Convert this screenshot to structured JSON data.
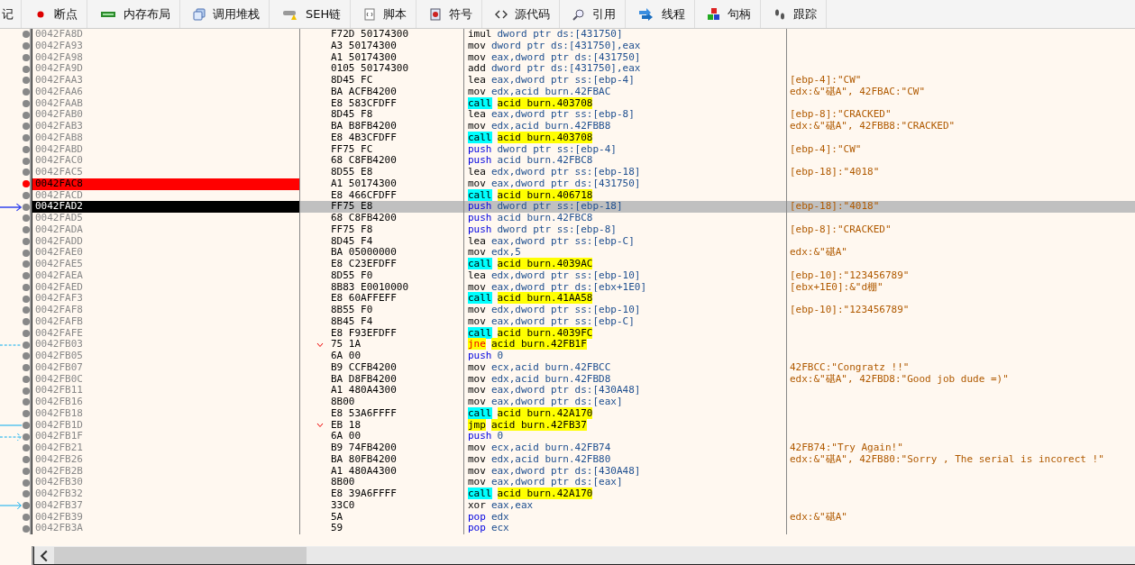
{
  "tabs": [
    {
      "label": "记",
      "selected": false
    },
    {
      "label": "断点",
      "selected": false
    },
    {
      "label": "内存布局",
      "selected": false
    },
    {
      "label": "调用堆栈",
      "selected": false
    },
    {
      "label": "SEH链",
      "selected": false
    },
    {
      "label": "脚本",
      "selected": false
    },
    {
      "label": "符号",
      "selected": false
    },
    {
      "label": "源代码",
      "selected": false
    },
    {
      "label": "引用",
      "selected": false
    },
    {
      "label": "线程",
      "selected": false
    },
    {
      "label": "句柄",
      "selected": false
    },
    {
      "label": "跟踪",
      "selected": false
    }
  ],
  "rows": [
    {
      "address": "0042FA8D",
      "bytes": "F72D 50174300",
      "kind": "plain",
      "mnemonic": "imul",
      "operands": "dword ptr ds:[431750]",
      "breakpoint": false,
      "selected": false,
      "branch": false
    },
    {
      "address": "0042FA93",
      "bytes": "A3 50174300",
      "kind": "plain",
      "mnemonic": "mov",
      "operands": "dword ptr ds:[431750],eax",
      "breakpoint": false,
      "selected": false,
      "branch": false
    },
    {
      "address": "0042FA98",
      "bytes": "A1 50174300",
      "kind": "plain",
      "mnemonic": "mov",
      "operands": "eax,dword ptr ds:[431750]",
      "breakpoint": false,
      "selected": false,
      "branch": false
    },
    {
      "address": "0042FA9D",
      "bytes": "0105 50174300",
      "kind": "plain",
      "mnemonic": "add",
      "operands": "dword ptr ds:[431750],eax",
      "breakpoint": false,
      "selected": false,
      "branch": false
    },
    {
      "address": "0042FAA3",
      "bytes": "8D45 FC",
      "kind": "plain",
      "mnemonic": "lea",
      "operands": "eax,dword ptr ss:[ebp-4]",
      "comment": "[ebp-4]:\"CW\"",
      "breakpoint": false,
      "selected": false,
      "branch": false
    },
    {
      "address": "0042FAA6",
      "bytes": "BA ACFB4200",
      "kind": "plain",
      "mnemonic": "mov",
      "operands": "edx,acid burn.42FBAC",
      "comment": "edx:&\"碪A\", 42FBAC:\"CW\"",
      "breakpoint": false,
      "selected": false,
      "branch": false
    },
    {
      "address": "0042FAAB",
      "bytes": "E8 583CFDFF",
      "kind": "call",
      "mnemonic": "call",
      "operands": "acid burn.403708",
      "breakpoint": false,
      "selected": false,
      "branch": false
    },
    {
      "address": "0042FAB0",
      "bytes": "8D45 F8",
      "kind": "plain",
      "mnemonic": "lea",
      "operands": "eax,dword ptr ss:[ebp-8]",
      "comment": "[ebp-8]:\"CRACKED\"",
      "breakpoint": false,
      "selected": false,
      "branch": false
    },
    {
      "address": "0042FAB3",
      "bytes": "BA B8FB4200",
      "kind": "plain",
      "mnemonic": "mov",
      "operands": "edx,acid burn.42FBB8",
      "comment": "edx:&\"碪A\", 42FBB8:\"CRACKED\"",
      "breakpoint": false,
      "selected": false,
      "branch": false
    },
    {
      "address": "0042FAB8",
      "bytes": "E8 4B3CFDFF",
      "kind": "call",
      "mnemonic": "call",
      "operands": "acid burn.403708",
      "breakpoint": false,
      "selected": false,
      "branch": false
    },
    {
      "address": "0042FABD",
      "bytes": "FF75 FC",
      "kind": "stack",
      "mnemonic": "push",
      "operands": "dword ptr ss:[ebp-4]",
      "comment": "[ebp-4]:\"CW\"",
      "breakpoint": false,
      "selected": false,
      "branch": false
    },
    {
      "address": "0042FAC0",
      "bytes": "68 C8FB4200",
      "kind": "stack",
      "mnemonic": "push",
      "operands": "acid burn.42FBC8",
      "breakpoint": false,
      "selected": false,
      "branch": false
    },
    {
      "address": "0042FAC5",
      "bytes": "8D55 E8",
      "kind": "plain",
      "mnemonic": "lea",
      "operands": "edx,dword ptr ss:[ebp-18]",
      "comment": "[ebp-18]:\"4018\"",
      "breakpoint": false,
      "selected": false,
      "branch": false
    },
    {
      "address": "0042FAC8",
      "bytes": "A1 50174300",
      "kind": "plain",
      "mnemonic": "mov",
      "operands": "eax,dword ptr ds:[431750]",
      "breakpoint": true,
      "selected": false,
      "branch": false
    },
    {
      "address": "0042FACD",
      "bytes": "E8 466CFDFF",
      "kind": "call",
      "mnemonic": "call",
      "operands": "acid burn.406718",
      "breakpoint": false,
      "selected": false,
      "branch": false
    },
    {
      "address": "0042FAD2",
      "bytes": "FF75 E8",
      "kind": "stack",
      "mnemonic": "push",
      "operands": "dword ptr ss:[ebp-18]",
      "comment": "[ebp-18]:\"4018\"",
      "breakpoint": false,
      "selected": true,
      "branch": false,
      "gutter": {
        "kind": "eip"
      }
    },
    {
      "address": "0042FAD5",
      "bytes": "68 C8FB4200",
      "kind": "stack",
      "mnemonic": "push",
      "operands": "acid burn.42FBC8",
      "breakpoint": false,
      "selected": false,
      "branch": false
    },
    {
      "address": "0042FADA",
      "bytes": "FF75 F8",
      "kind": "stack",
      "mnemonic": "push",
      "operands": "dword ptr ss:[ebp-8]",
      "comment": "[ebp-8]:\"CRACKED\"",
      "breakpoint": false,
      "selected": false,
      "branch": false
    },
    {
      "address": "0042FADD",
      "bytes": "8D45 F4",
      "kind": "plain",
      "mnemonic": "lea",
      "operands": "eax,dword ptr ss:[ebp-C]",
      "breakpoint": false,
      "selected": false,
      "branch": false
    },
    {
      "address": "0042FAE0",
      "bytes": "BA 05000000",
      "kind": "plain",
      "mnemonic": "mov",
      "operands": "edx,5",
      "comment": "edx:&\"碪A\"",
      "breakpoint": false,
      "selected": false,
      "branch": false
    },
    {
      "address": "0042FAE5",
      "bytes": "E8 C23EFDFF",
      "kind": "call",
      "mnemonic": "call",
      "operands": "acid burn.4039AC",
      "breakpoint": false,
      "selected": false,
      "branch": false
    },
    {
      "address": "0042FAEA",
      "bytes": "8D55 F0",
      "kind": "plain",
      "mnemonic": "lea",
      "operands": "edx,dword ptr ss:[ebp-10]",
      "comment": "[ebp-10]:\"123456789\"",
      "breakpoint": false,
      "selected": false,
      "branch": false
    },
    {
      "address": "0042FAED",
      "bytes": "8B83 E0010000",
      "kind": "plain",
      "mnemonic": "mov",
      "operands": "eax,dword ptr ds:[ebx+1E0]",
      "comment": "[ebx+1E0]:&\"d棚\"",
      "breakpoint": false,
      "selected": false,
      "branch": false
    },
    {
      "address": "0042FAF3",
      "bytes": "E8 60AFFEFF",
      "kind": "call",
      "mnemonic": "call",
      "operands": "acid burn.41AA58",
      "breakpoint": false,
      "selected": false,
      "branch": false
    },
    {
      "address": "0042FAF8",
      "bytes": "8B55 F0",
      "kind": "plain",
      "mnemonic": "mov",
      "operands": "edx,dword ptr ss:[ebp-10]",
      "comment": "[ebp-10]:\"123456789\"",
      "breakpoint": false,
      "selected": false,
      "branch": false
    },
    {
      "address": "0042FAFB",
      "bytes": "8B45 F4",
      "kind": "plain",
      "mnemonic": "mov",
      "operands": "eax,dword ptr ss:[ebp-C]",
      "breakpoint": false,
      "selected": false,
      "branch": false
    },
    {
      "address": "0042FAFE",
      "bytes": "E8 F93EFDFF",
      "kind": "call",
      "mnemonic": "call",
      "operands": "acid burn.4039FC",
      "breakpoint": false,
      "selected": false,
      "branch": false
    },
    {
      "address": "0042FB03",
      "bytes": "75 1A",
      "kind": "cond-jump",
      "mnemonic": "jne",
      "operands": "acid burn.42FB1F",
      "breakpoint": false,
      "selected": false,
      "branch": true,
      "gutter": {
        "kind": "from-dashed"
      }
    },
    {
      "address": "0042FB05",
      "bytes": "6A 00",
      "kind": "stack",
      "mnemonic": "push",
      "operands": "0",
      "breakpoint": false,
      "selected": false,
      "branch": false
    },
    {
      "address": "0042FB07",
      "bytes": "B9 CCFB4200",
      "kind": "plain",
      "mnemonic": "mov",
      "operands": "ecx,acid burn.42FBCC",
      "comment": "42FBCC:\"Congratz !!\"",
      "breakpoint": false,
      "selected": false,
      "branch": false
    },
    {
      "address": "0042FB0C",
      "bytes": "BA D8FB4200",
      "kind": "plain",
      "mnemonic": "mov",
      "operands": "edx,acid burn.42FBD8",
      "comment": "edx:&\"碪A\", 42FBD8:\"Good job dude =)\"",
      "breakpoint": false,
      "selected": false,
      "branch": false
    },
    {
      "address": "0042FB11",
      "bytes": "A1 480A4300",
      "kind": "plain",
      "mnemonic": "mov",
      "operands": "eax,dword ptr ds:[430A48]",
      "breakpoint": false,
      "selected": false,
      "branch": false
    },
    {
      "address": "0042FB16",
      "bytes": "8B00",
      "kind": "plain",
      "mnemonic": "mov",
      "operands": "eax,dword ptr ds:[eax]",
      "breakpoint": false,
      "selected": false,
      "branch": false
    },
    {
      "address": "0042FB18",
      "bytes": "E8 53A6FFFF",
      "kind": "call",
      "mnemonic": "call",
      "operands": "acid burn.42A170",
      "breakpoint": false,
      "selected": false,
      "branch": false
    },
    {
      "address": "0042FB1D",
      "bytes": "EB 18",
      "kind": "jump",
      "mnemonic": "jmp",
      "operands": "acid burn.42FB37",
      "breakpoint": false,
      "selected": false,
      "branch": true,
      "gutter": {
        "kind": "from"
      }
    },
    {
      "address": "0042FB1F",
      "bytes": "6A 00",
      "kind": "stack",
      "mnemonic": "push",
      "operands": "0",
      "breakpoint": false,
      "selected": false,
      "branch": false,
      "gutter": {
        "kind": "to-dashed"
      }
    },
    {
      "address": "0042FB21",
      "bytes": "B9 74FB4200",
      "kind": "plain",
      "mnemonic": "mov",
      "operands": "ecx,acid burn.42FB74",
      "comment": "42FB74:\"Try Again!\"",
      "breakpoint": false,
      "selected": false,
      "branch": false
    },
    {
      "address": "0042FB26",
      "bytes": "BA 80FB4200",
      "kind": "plain",
      "mnemonic": "mov",
      "operands": "edx,acid burn.42FB80",
      "comment": "edx:&\"碪A\", 42FB80:\"Sorry , The serial is incorect !\"",
      "breakpoint": false,
      "selected": false,
      "branch": false
    },
    {
      "address": "0042FB2B",
      "bytes": "A1 480A4300",
      "kind": "plain",
      "mnemonic": "mov",
      "operands": "eax,dword ptr ds:[430A48]",
      "breakpoint": false,
      "selected": false,
      "branch": false
    },
    {
      "address": "0042FB30",
      "bytes": "8B00",
      "kind": "plain",
      "mnemonic": "mov",
      "operands": "eax,dword ptr ds:[eax]",
      "breakpoint": false,
      "selected": false,
      "branch": false
    },
    {
      "address": "0042FB32",
      "bytes": "E8 39A6FFFF",
      "kind": "call",
      "mnemonic": "call",
      "operands": "acid burn.42A170",
      "breakpoint": false,
      "selected": false,
      "branch": false
    },
    {
      "address": "0042FB37",
      "bytes": "33C0",
      "kind": "plain",
      "mnemonic": "xor",
      "operands": "eax,eax",
      "breakpoint": false,
      "selected": false,
      "branch": false,
      "gutter": {
        "kind": "to"
      }
    },
    {
      "address": "0042FB39",
      "bytes": "5A",
      "kind": "stack",
      "mnemonic": "pop",
      "operands": "edx",
      "comment": "edx:&\"碪A\"",
      "breakpoint": false,
      "selected": false,
      "branch": false
    },
    {
      "address": "0042FB3A",
      "bytes": "59",
      "kind": "stack",
      "mnemonic": "pop",
      "operands": "ecx",
      "breakpoint": false,
      "selected": false,
      "branch": false
    }
  ]
}
